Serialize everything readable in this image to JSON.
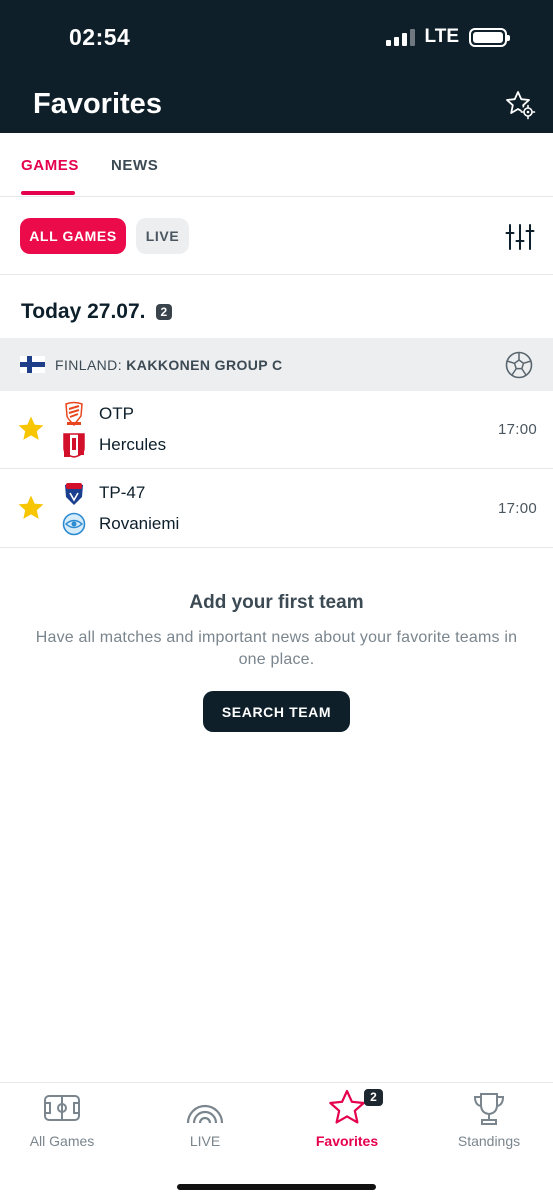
{
  "status_bar": {
    "time": "02:54",
    "network": "LTE"
  },
  "header": {
    "title": "Favorites"
  },
  "tabs": [
    {
      "label": "GAMES",
      "active": true
    },
    {
      "label": "NEWS",
      "active": false
    }
  ],
  "filters": [
    {
      "label": "ALL GAMES",
      "active": true
    },
    {
      "label": "LIVE",
      "active": false
    }
  ],
  "date_section": {
    "label": "Today 27.07.",
    "count": "2"
  },
  "league": {
    "country": "FINLAND:",
    "name": "KAKKONEN GROUP C"
  },
  "matches": [
    {
      "home": "OTP",
      "away": "Hercules",
      "time": "17:00",
      "favorite": true
    },
    {
      "home": "TP-47",
      "away": "Rovaniemi",
      "time": "17:00",
      "favorite": true
    }
  ],
  "empty_state": {
    "title": "Add your first team",
    "description": "Have all matches and important news about your favorite teams in one place.",
    "button": "SEARCH TEAM"
  },
  "bottom_nav": {
    "items": [
      {
        "label": "All Games",
        "icon": "pitch-icon"
      },
      {
        "label": "LIVE",
        "icon": "live-signal-icon"
      },
      {
        "label": "Favorites",
        "icon": "star-icon",
        "active": true
      },
      {
        "label": "Standings",
        "icon": "trophy-icon"
      }
    ],
    "favorites_badge": "2"
  },
  "colors": {
    "accent": "#e5004d",
    "header_bg": "#0e1f29",
    "star": "#f7c600"
  }
}
